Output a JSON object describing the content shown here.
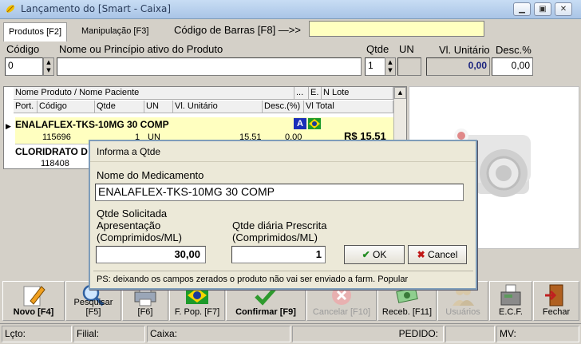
{
  "window": {
    "title": "Lançamento do [Smart - Caixa]",
    "icons": {
      "app": "pill-icon",
      "minimize": "minimize-icon",
      "maximize": "maximize-icon",
      "close": "close-icon"
    }
  },
  "tabs": [
    {
      "label": "Produtos [F2]",
      "active": true
    },
    {
      "label": "Manipulação [F3]",
      "active": false
    }
  ],
  "barcode": {
    "label": "Código de Barras [F8] —>>",
    "value": ""
  },
  "form": {
    "codigo_label": "Código",
    "codigo_value": "0",
    "nome_label": "Nome ou Princípio ativo do Produto",
    "nome_value": "",
    "qtde_label": "Qtde",
    "qtde_value": "1",
    "un_label": "UN",
    "un_value": "",
    "vl_unitario_label": "Vl. Unitário",
    "vl_unitario_value": "0,00",
    "desc_label": "Desc.%",
    "desc_value": "0,00"
  },
  "grid": {
    "header_row1": [
      "Nome Produto / Nome Paciente",
      "...",
      "E.",
      "N Lote"
    ],
    "header_row2": [
      "Port.",
      "Código",
      "Qtde",
      "UN",
      "Vl. Unitário",
      "Desc.(%)",
      "Vl Total"
    ],
    "rows": [
      {
        "nome": "ENALAFLEX-TKS-10MG 30 COMP",
        "codigo": "115696",
        "qtde": "1",
        "un": "UN",
        "vl_unitario": "15,51",
        "desc": "0,00",
        "total": "R$ 15,51",
        "badge": "A"
      },
      {
        "nome": "CLORIDRATO D",
        "codigo": "118408"
      }
    ]
  },
  "toolbar": [
    {
      "label": "Novo [F4]",
      "icon": "pencil-icon",
      "enabled": true
    },
    {
      "label": "Pesquisar [F5]",
      "icon": "magnifier-icon",
      "enabled": true
    },
    {
      "label": "[F6]",
      "icon": "printer-icon",
      "enabled": true
    },
    {
      "label": "F. Pop. [F7]",
      "icon": "brazil-flag-icon",
      "enabled": true
    },
    {
      "label": "Confirmar [F9]",
      "icon": "checkmark-icon",
      "enabled": true
    },
    {
      "label": "Cancelar [F10]",
      "icon": "cancel-icon",
      "enabled": false
    },
    {
      "label": "Receb. [F11]",
      "icon": "money-icon",
      "enabled": true
    },
    {
      "label": "Usuários",
      "icon": "users-icon",
      "enabled": false
    },
    {
      "label": "E.C.F.",
      "icon": "register-icon",
      "enabled": true
    },
    {
      "label": "Fechar",
      "icon": "exit-door-icon",
      "enabled": true
    }
  ],
  "statusbar": {
    "lcto": "Lçto:",
    "filial": "Filial:",
    "caixa": "Caixa:",
    "pedido": "PEDIDO:",
    "mv": "MV:"
  },
  "dialog": {
    "title": "Informa a Qtde",
    "nome_label": "Nome do Medicamento",
    "nome_value": "ENALAFLEX-TKS-10MG 30 COMP",
    "qtde_sol_label1": "Qtde Solicitada",
    "qtde_sol_label2": "Apresentação",
    "qtde_sol_label3": "(Comprimidos/ML)",
    "qtde_sol_value": "30,00",
    "qtde_diaria_label1": "Qtde diária Prescrita",
    "qtde_diaria_label2": "(Comprimidos/ML)",
    "qtde_diaria_value": "1",
    "ok_label": "OK",
    "cancel_label": "Cancel",
    "note": "PS: deixando os campos zerados o produto não vai ser enviado a farm. Popular"
  }
}
